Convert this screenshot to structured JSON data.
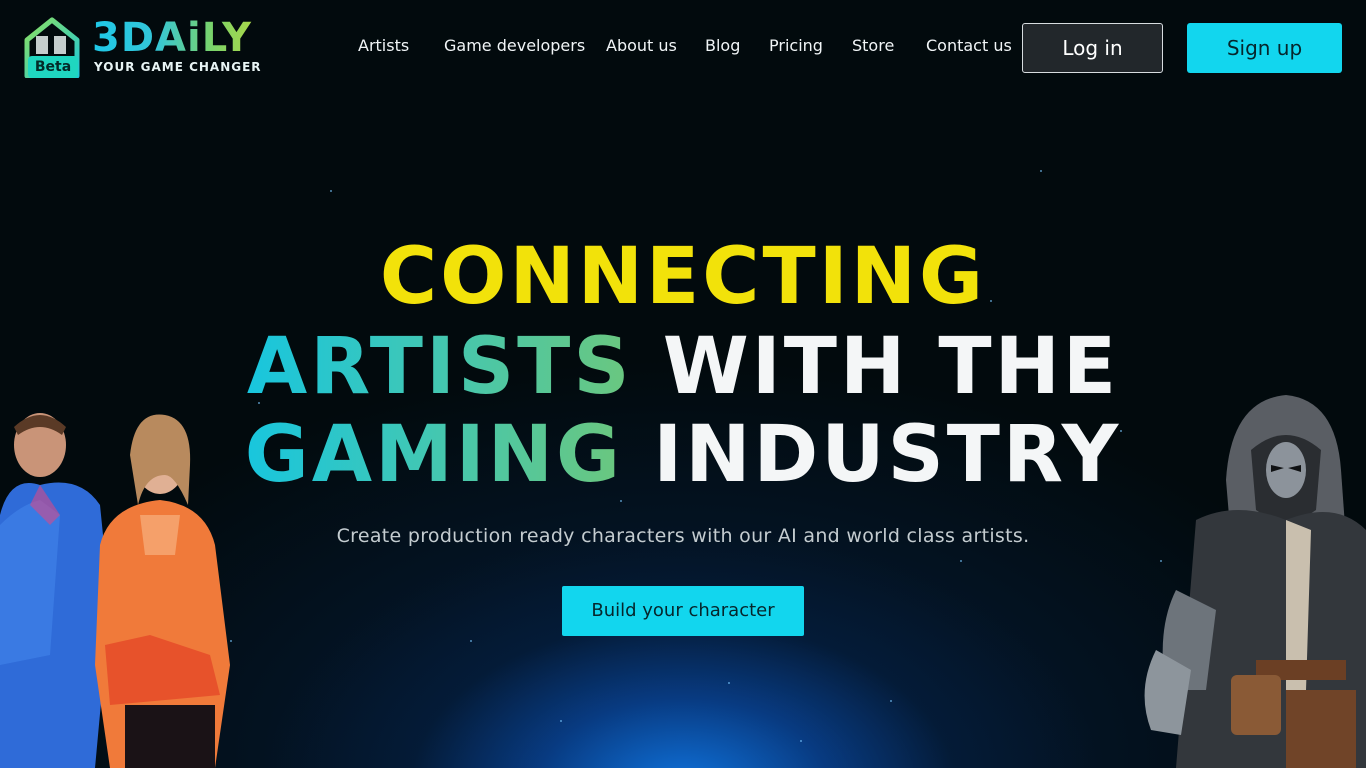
{
  "brand": {
    "name": "3DAiLY",
    "tagline": "YOUR GAME CHANGER",
    "badge": "Beta"
  },
  "nav": {
    "items": [
      {
        "label": "Artists"
      },
      {
        "label": "Game developers"
      },
      {
        "label": "About us"
      },
      {
        "label": "Blog"
      },
      {
        "label": "Pricing"
      },
      {
        "label": "Store"
      },
      {
        "label": "Contact us"
      }
    ],
    "login_label": "Log in",
    "signup_label": "Sign up"
  },
  "hero": {
    "line1": "CONNECTING",
    "line2_accent": "ARTISTS",
    "line2_rest": "WITH THE",
    "line3_accent": "GAMING",
    "line3_rest": "INDUSTRY",
    "subtitle": "Create production ready characters with our AI and world class artists.",
    "cta_label": "Build your character"
  },
  "colors": {
    "accent_cyan": "#12d6ee",
    "headline_yellow": "#f2e20a",
    "background": "#020a0d"
  },
  "icons": {
    "logo": "house-cube-logo-icon"
  }
}
